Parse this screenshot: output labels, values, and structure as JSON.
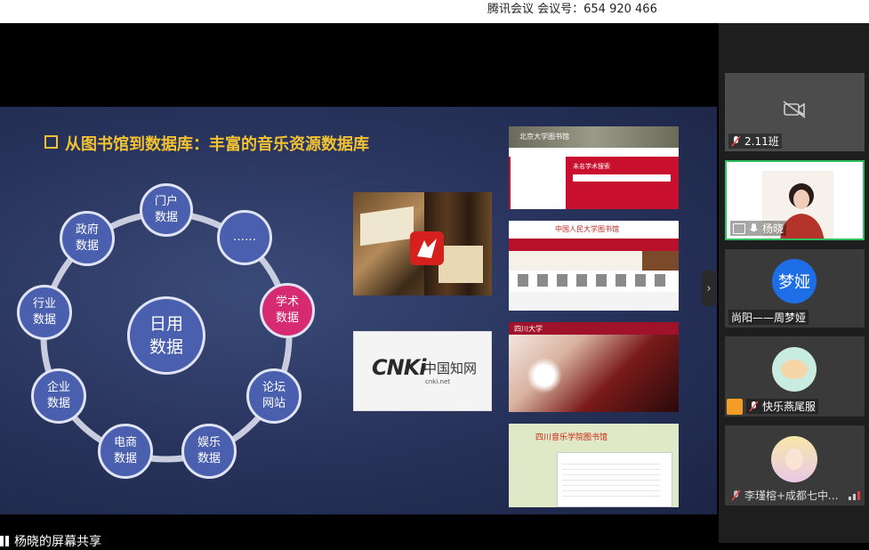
{
  "meeting": {
    "title": "腾讯会议 会议号：654 920 466"
  },
  "slide": {
    "title": "从图书馆到数据库：丰富的音乐资源数据库",
    "center_node": "日用数据",
    "nodes": [
      {
        "label": "门户数据",
        "color": "#4a5fae"
      },
      {
        "label": "……",
        "color": "#4a5fae"
      },
      {
        "label": "学术数据",
        "color": "#d62a72"
      },
      {
        "label": "论坛网站",
        "color": "#4a5fae"
      },
      {
        "label": "娱乐数据",
        "color": "#4a5fae"
      },
      {
        "label": "电商数据",
        "color": "#4a5fae"
      },
      {
        "label": "企业数据",
        "color": "#4a5fae"
      },
      {
        "label": "行业数据",
        "color": "#4a5fae"
      },
      {
        "label": "政府数据",
        "color": "#4a5fae"
      }
    ],
    "cnki": {
      "logo": "CNKi",
      "cn_name": "中国知网",
      "url": "cnki.net"
    },
    "screenshots": [
      {
        "name": "北京大学图书馆",
        "search_hint": "未名学术搜索"
      },
      {
        "name": "中国人民大学图书馆"
      },
      {
        "name": "四川大学"
      },
      {
        "name": "四川音乐学院图书馆"
      }
    ]
  },
  "participants": [
    {
      "name": "2.11班",
      "camera": "off",
      "mic": "muted"
    },
    {
      "name": "杨晓",
      "camera": "on",
      "mic": "on",
      "sharing": true
    },
    {
      "name": "尚阳——周梦娅",
      "avatar_text": "梦娅",
      "avatar_color": "#1e6ee8"
    },
    {
      "name": "快乐燕尾服",
      "mic": "muted"
    },
    {
      "name": "李瑾榕+成都七中...",
      "mic": "muted"
    }
  ],
  "share_label": "杨晓的屏幕共享"
}
